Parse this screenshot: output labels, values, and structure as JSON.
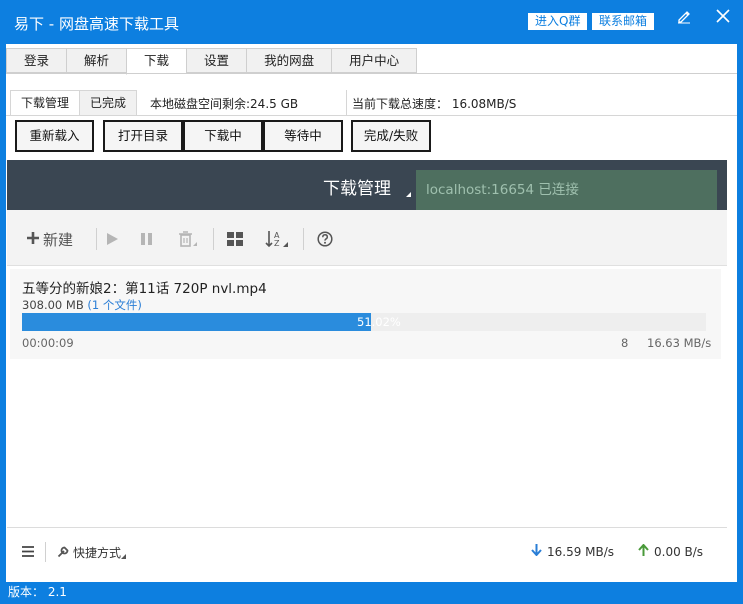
{
  "window": {
    "title": "易下 - 网盘高速下载工具",
    "join_qq_label": "进入Q群",
    "contact_email_label": "联系邮箱"
  },
  "tabs": [
    {
      "label": "登录"
    },
    {
      "label": "解析"
    },
    {
      "label": "下载",
      "active": true
    },
    {
      "label": "设置"
    },
    {
      "label": "我的网盘"
    },
    {
      "label": "用户中心"
    }
  ],
  "download_panel": {
    "subtabs": [
      {
        "label": "下载管理",
        "active": true
      },
      {
        "label": "已完成"
      }
    ],
    "disk_space": "本地磁盘空间剩余:24.5 GB",
    "total_speed": "当前下载总速度： 16.08MB/S",
    "buttons": {
      "reload": "重新载入",
      "open_dir": "打开目录",
      "downloading": "下载中",
      "waiting": "等待中",
      "done_failed": "完成/失败"
    }
  },
  "manager": {
    "title": "下载管理",
    "toast": "localhost:16654 已连接",
    "toolbar": {
      "new_label": "新建"
    },
    "items": [
      {
        "name": "五等分的新娘2：第11话 720P nvl.mp4",
        "size": "308.00 MB",
        "files": "(1 个文件)",
        "progress_percent": 51.02,
        "progress_label": "51.02%",
        "elapsed": "00:00:09",
        "connections": "8",
        "speed": "16.63 MB/s"
      }
    ],
    "footer": {
      "shortcut_label": "快捷方式",
      "download_speed": "16.59 MB/s",
      "upload_speed": "0.00 B/s"
    }
  },
  "statusbar": {
    "version": "版本： 2.1"
  },
  "colors": {
    "accent": "#0d7fe0",
    "progress": "#2a8cdd",
    "header_dark": "#3a4652",
    "download_arrow": "#2a7ed6",
    "upload_arrow": "#4a9a3a"
  }
}
